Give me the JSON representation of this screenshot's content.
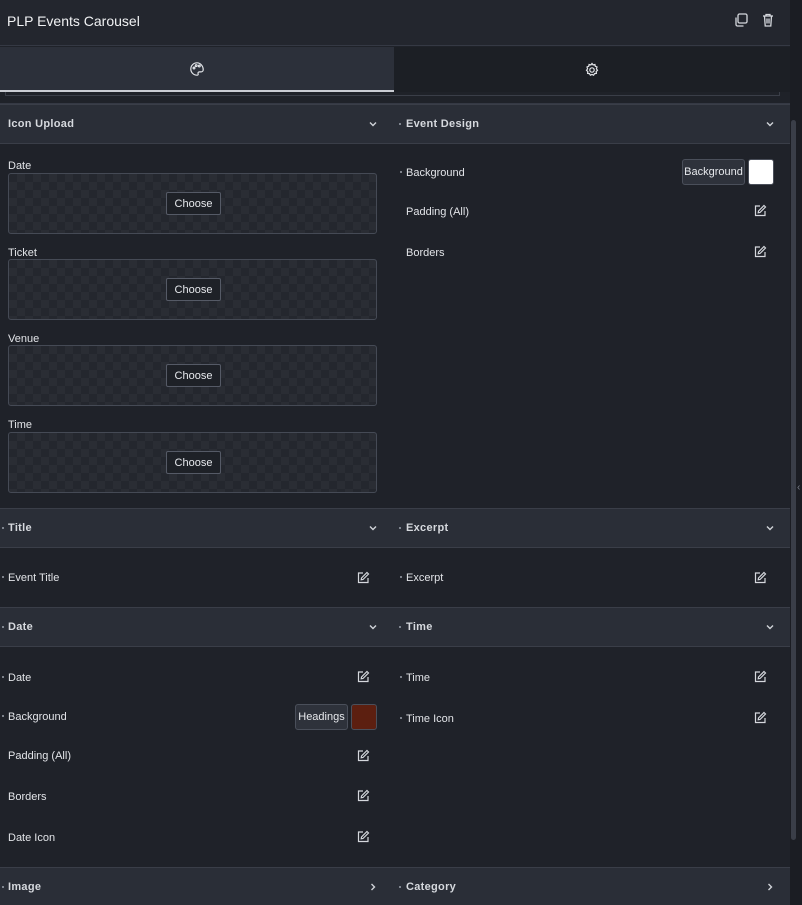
{
  "header": {
    "title": "PLP Events Carousel",
    "duplicate_icon": "duplicate-icon",
    "delete_icon": "trash-icon"
  },
  "tabs": [
    {
      "icon": "palette-icon",
      "active": true
    },
    {
      "icon": "gear-icon",
      "active": false
    }
  ],
  "sections": {
    "icon_upload": {
      "title": "Icon Upload",
      "fields": [
        {
          "label": "Date",
          "button": "Choose"
        },
        {
          "label": "Ticket",
          "button": "Choose"
        },
        {
          "label": "Venue",
          "button": "Choose"
        },
        {
          "label": "Time",
          "button": "Choose"
        }
      ]
    },
    "event_design": {
      "title": "Event Design",
      "background_label": "Background",
      "background_button": "Background",
      "background_color": "#ffffff",
      "padding_label": "Padding (All)",
      "borders_label": "Borders"
    },
    "title": {
      "title": "Title",
      "event_title_label": "Event Title"
    },
    "excerpt": {
      "title": "Excerpt",
      "excerpt_label": "Excerpt"
    },
    "date": {
      "title": "Date",
      "date_label": "Date",
      "background_label": "Background",
      "background_button": "Headings",
      "background_color": "#5c1f10",
      "padding_label": "Padding (All)",
      "borders_label": "Borders",
      "date_icon_label": "Date Icon"
    },
    "time": {
      "title": "Time",
      "time_label": "Time",
      "time_icon_label": "Time Icon"
    },
    "image": {
      "title": "Image"
    },
    "category": {
      "title": "Category"
    }
  },
  "colors": {
    "panel_bg": "#1f2229",
    "section_header_bg": "#2a2e37",
    "text": "#e6e8ec"
  }
}
